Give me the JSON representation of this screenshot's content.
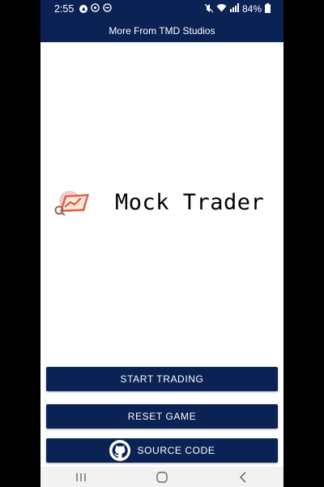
{
  "status_bar": {
    "time": "2:55",
    "battery": "84%",
    "left_icons": [
      "arrow-icon",
      "whatsapp-icon",
      "minus-circle-icon"
    ],
    "right_icons": [
      "mute-icon",
      "wifi-icon",
      "signal-icon",
      "battery-icon"
    ]
  },
  "header": {
    "title": "More From TMD Studios"
  },
  "main": {
    "app_name": "Mock Trader",
    "logo_icon": "trader-logo-icon"
  },
  "buttons": {
    "start_label": "START TRADING",
    "reset_label": "RESET GAME",
    "source_label": "SOURCE CODE",
    "source_icon": "github-icon"
  },
  "nav": {
    "items": [
      "recent-apps-icon",
      "home-icon",
      "back-icon"
    ]
  },
  "colors": {
    "primary": "#0b2255",
    "background": "#ffffff",
    "nav_bar": "#f2f2f2"
  }
}
